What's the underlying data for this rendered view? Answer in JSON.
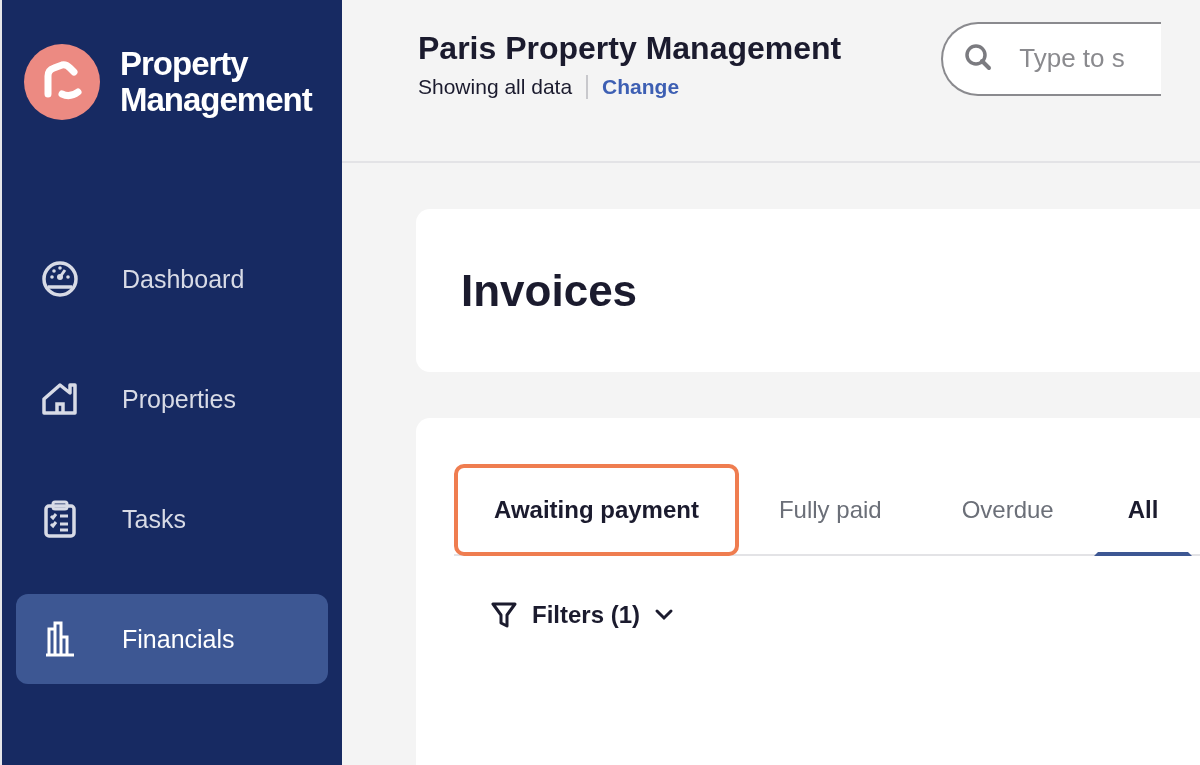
{
  "brand": {
    "name": "Property Management"
  },
  "sidebar": {
    "items": [
      {
        "label": "Dashboard",
        "kind": "gauge",
        "selected": false
      },
      {
        "label": "Properties",
        "kind": "house",
        "selected": false
      },
      {
        "label": "Tasks",
        "kind": "clipboard",
        "selected": false
      },
      {
        "label": "Financials",
        "kind": "chart",
        "selected": true
      }
    ]
  },
  "header": {
    "title": "Paris Property Management",
    "subtitle": "Showing all data",
    "link": "Change",
    "search": {
      "placeholder": "Type to s"
    }
  },
  "page": {
    "title": "Invoices"
  },
  "tabs": [
    {
      "label": "Awaiting payment",
      "selected": false,
      "highlighted": true
    },
    {
      "label": "Fully paid",
      "selected": false,
      "highlighted": false
    },
    {
      "label": "Overdue",
      "selected": false,
      "highlighted": false
    },
    {
      "label": "All",
      "selected": true,
      "highlighted": false
    }
  ],
  "filters": {
    "label": "Filters (1)"
  }
}
